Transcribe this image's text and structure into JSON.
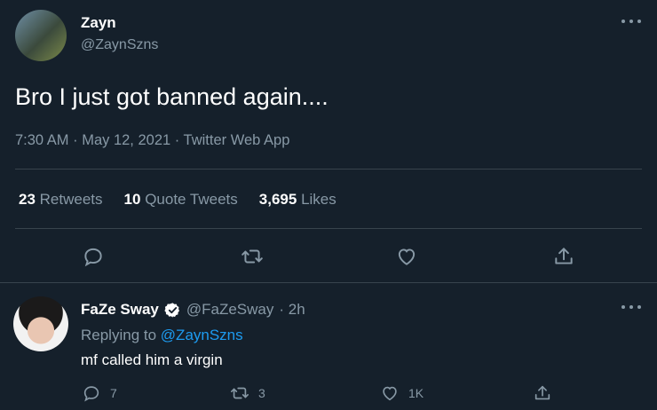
{
  "tweet": {
    "author_name": "Zayn",
    "author_handle": "@ZaynSzns",
    "text": "Bro I just got banned again....",
    "meta": "7:30 AM · May 12, 2021 · Twitter Web App",
    "stats": [
      {
        "count": "23",
        "label": "Retweets"
      },
      {
        "count": "10",
        "label": "Quote Tweets"
      },
      {
        "count": "3,695",
        "label": "Likes"
      }
    ],
    "actions": [
      "reply-icon",
      "retweet-icon",
      "like-icon",
      "share-icon"
    ]
  },
  "reply": {
    "author_name": "FaZe Sway",
    "author_handle": "@FaZeSway",
    "time": "· 2h",
    "replying_prefix": "Replying to",
    "replying_to": "@ZaynSzns",
    "text": "mf called him a virgin",
    "counts": {
      "replies": "7",
      "retweets": "3",
      "likes": "1K"
    }
  },
  "colors": {
    "background": "#15202b",
    "muted": "#8899a6",
    "accent": "#1d9bf0",
    "divider": "#38444d"
  }
}
